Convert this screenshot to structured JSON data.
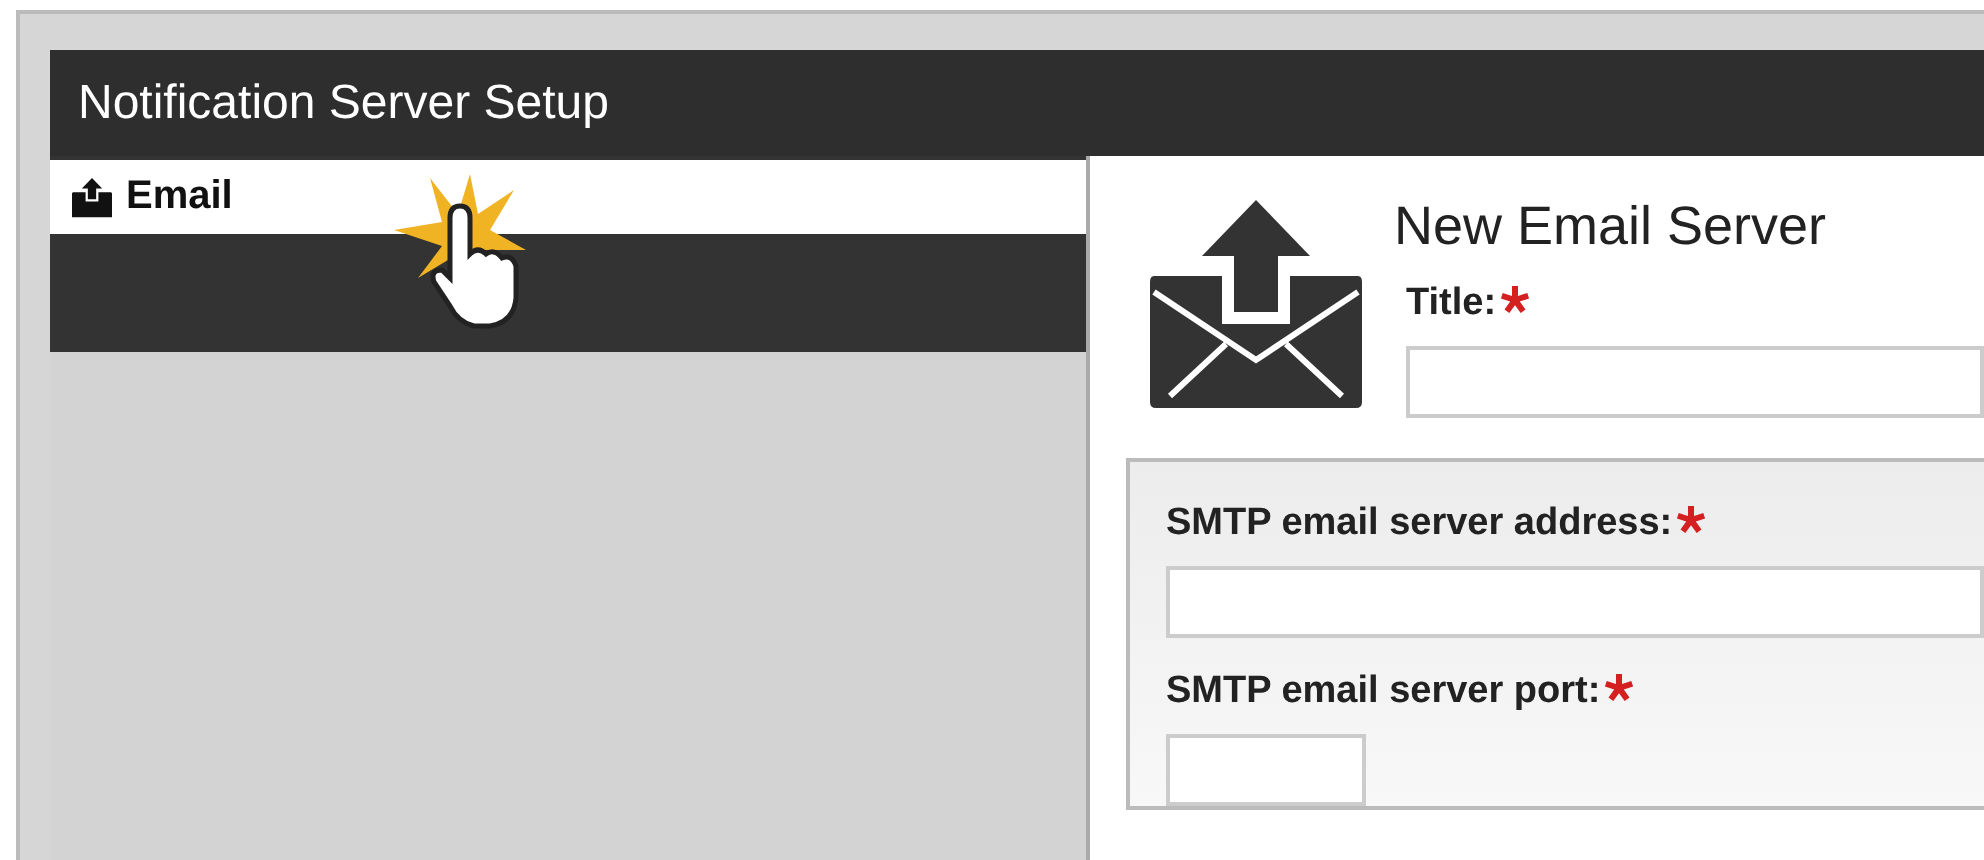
{
  "window": {
    "title": "Notification Server Setup"
  },
  "sidebar": {
    "items": [
      {
        "label": "Email",
        "selected": true
      }
    ]
  },
  "form": {
    "heading": "New Email Server",
    "title_field": {
      "label": "Title:",
      "required": true
    },
    "fields": [
      {
        "label": "SMTP email server address:",
        "required": true,
        "kind": "wide"
      },
      {
        "label": "SMTP email server port:",
        "required": true,
        "kind": "short"
      }
    ]
  }
}
